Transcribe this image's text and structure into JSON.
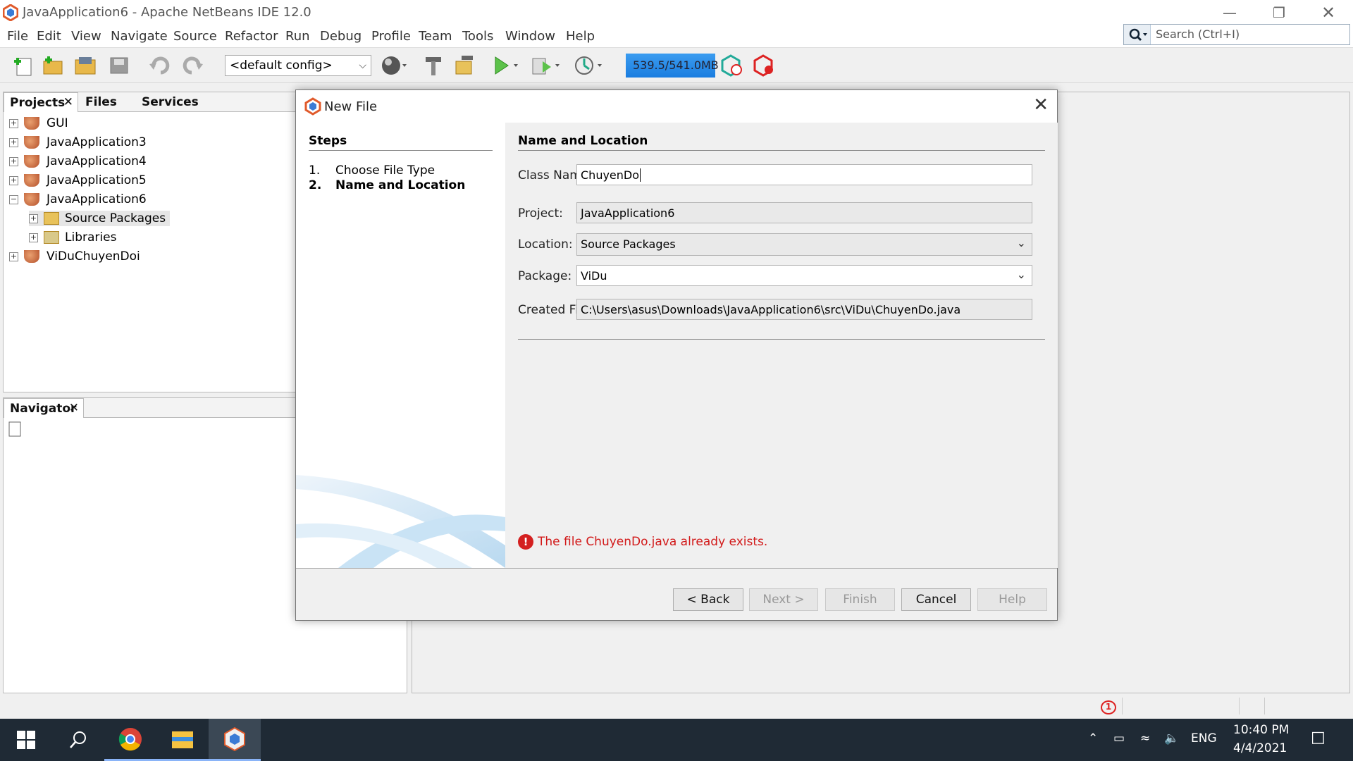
{
  "window": {
    "title": "JavaApplication6 - Apache NetBeans IDE 12.0"
  },
  "menu": [
    "File",
    "Edit",
    "View",
    "Navigate",
    "Source",
    "Refactor",
    "Run",
    "Debug",
    "Profile",
    "Team",
    "Tools",
    "Window",
    "Help"
  ],
  "search": {
    "placeholder": "Search (Ctrl+I)"
  },
  "toolbar": {
    "config": "<default config>",
    "memory": "539.5/541.0MB"
  },
  "projects_panel": {
    "tabs": [
      "Projects",
      "Files",
      "Services"
    ],
    "items": [
      {
        "label": "GUI"
      },
      {
        "label": "JavaApplication3"
      },
      {
        "label": "JavaApplication4"
      },
      {
        "label": "JavaApplication5"
      },
      {
        "label": "JavaApplication6"
      },
      {
        "label": "Source Packages"
      },
      {
        "label": "Libraries"
      },
      {
        "label": "ViDuChuyenDoi"
      }
    ]
  },
  "navigator_panel": {
    "title": "Navigator"
  },
  "dialog": {
    "title": "New File",
    "steps_header": "Steps",
    "steps": [
      {
        "num": "1.",
        "label": "Choose File Type"
      },
      {
        "num": "2.",
        "label": "Name and Location"
      }
    ],
    "section_header": "Name and Location",
    "class_name_label": "Class Name:",
    "class_name_value": "ChuyenDo",
    "project_label": "Project:",
    "project_value": "JavaApplication6",
    "location_label": "Location:",
    "location_value": "Source Packages",
    "package_label": "Package:",
    "package_value": "ViDu",
    "created_file_label": "Created File:",
    "created_file_value": "C:\\Users\\asus\\Downloads\\JavaApplication6\\src\\ViDu\\ChuyenDo.java",
    "error": "The file ChuyenDo.java already exists.",
    "buttons": {
      "back": "< Back",
      "next": "Next >",
      "finish": "Finish",
      "cancel": "Cancel",
      "help": "Help"
    }
  },
  "status": {
    "notifications": "1"
  },
  "taskbar": {
    "lang": "ENG",
    "time": "10:40 PM",
    "date": "4/4/2021"
  }
}
